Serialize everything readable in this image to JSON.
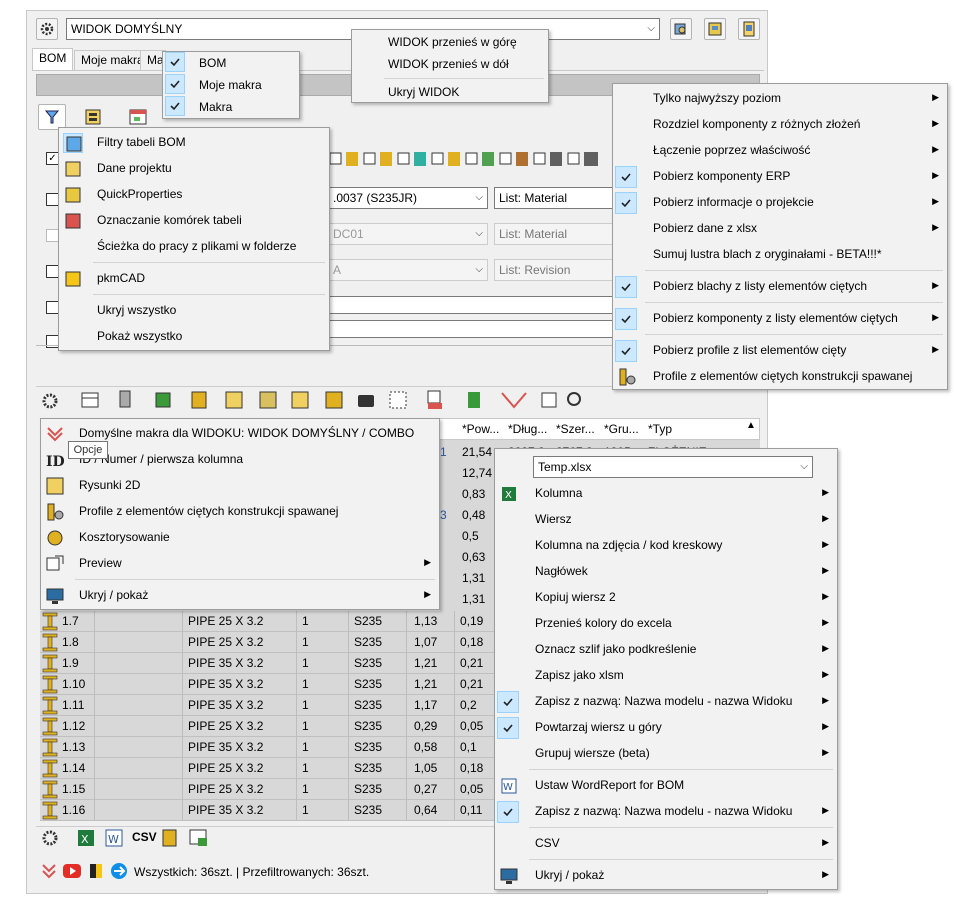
{
  "toolbar": {
    "view_select_value": "WIDOK DOMYŚLNY"
  },
  "tabs": [
    "BOM",
    "Moje makra",
    "Mak"
  ],
  "tab_menu": [
    {
      "label": "BOM",
      "checked": true
    },
    {
      "label": "Moje makra",
      "checked": true
    },
    {
      "label": "Makra",
      "checked": true
    }
  ],
  "view_menu": [
    "WIDOK przenieś w górę",
    "WIDOK przenieś w dół",
    "Ukryj WIDOK"
  ],
  "filter_menu": [
    "Filtry tabeli BOM",
    "Dane projektu",
    "QuickProperties",
    "Oznaczanie komórek tabeli",
    "Ścieżka do pracy z plikami w folderze",
    "pkmCAD",
    "Ukryj wszystko",
    "Pokaż wszystko"
  ],
  "erp_menu": [
    {
      "label": "Tylko najwyższy poziom",
      "checked": false,
      "submenu": true
    },
    {
      "label": "Rozdziel komponenty z różnych złożeń",
      "checked": false,
      "submenu": true
    },
    {
      "label": "Łączenie poprzez właściwość",
      "checked": false,
      "submenu": true
    },
    {
      "label": "Pobierz komponenty ERP",
      "checked": true,
      "submenu": true
    },
    {
      "label": "Pobierz informacje o projekcie",
      "checked": true,
      "submenu": true
    },
    {
      "label": "Pobierz dane z xlsx",
      "checked": false,
      "submenu": true
    },
    {
      "label": "Sumuj lustra blach z oryginałami - BETA!!!*",
      "checked": false,
      "submenu": false
    },
    {
      "label": "Pobierz blachy z listy elementów ciętych",
      "checked": true,
      "submenu": true
    },
    {
      "label": "Pobierz komponenty z listy elementów ciętych",
      "checked": true,
      "submenu": true
    },
    {
      "label": "Pobierz profile z list elementów cięty",
      "checked": true,
      "submenu": true
    },
    {
      "label": "Profile z elementów ciętych konstrukcji spawanej",
      "checked": false,
      "submenu": false
    }
  ],
  "mid_fields": {
    "material_value": ".0037 (S235JR)",
    "list_material_1": "List: Material",
    "dc_value": "DC01",
    "list_material_2": "List: Material",
    "a_value": "A",
    "list_revision": "List: Revision"
  },
  "options_menu": [
    "Domyślne makra dla WIDOKU: WIDOK DOMYŚLNY / COMBO",
    "ID / Numer / pierwsza kolumna",
    "Rysunki 2D",
    "Profile z elementów ciętych konstrukcji spawanej",
    "Kosztorysowanie",
    "Preview",
    "Ukryj / pokaż"
  ],
  "options_tooltip": "Opcje",
  "grid_headers": [
    "*Pow...",
    "*Dług...",
    "*Szer...",
    "*Gru...",
    "*Typ"
  ],
  "grid_peek": {
    "a": [
      "21,54",
      "12,74",
      "0,83",
      "0,48",
      "0,5",
      "0,63",
      "1,31",
      "1,31"
    ],
    "b": [
      "1",
      "",
      "",
      "3",
      "",
      "",
      "",
      ""
    ],
    "first_row": [
      "2237,2",
      "2767,8",
      "1805",
      "ZŁOŻENIE"
    ]
  },
  "rows": [
    {
      "id": "1.7",
      "name": "PIPE 25 X 3.2",
      "qty": "1",
      "mat": "S235",
      "v1": "1,13",
      "v2": "0,19"
    },
    {
      "id": "1.8",
      "name": "PIPE 25 X 3.2",
      "qty": "1",
      "mat": "S235",
      "v1": "1,07",
      "v2": "0,18"
    },
    {
      "id": "1.9",
      "name": "PIPE 35 X 3.2",
      "qty": "1",
      "mat": "S235",
      "v1": "1,21",
      "v2": "0,21"
    },
    {
      "id": "1.10",
      "name": "PIPE 35 X 3.2",
      "qty": "1",
      "mat": "S235",
      "v1": "1,21",
      "v2": "0,21"
    },
    {
      "id": "1.11",
      "name": "PIPE 35 X 3.2",
      "qty": "1",
      "mat": "S235",
      "v1": "1,17",
      "v2": "0,2"
    },
    {
      "id": "1.12",
      "name": "PIPE 25 X 3.2",
      "qty": "1",
      "mat": "S235",
      "v1": "0,29",
      "v2": "0,05"
    },
    {
      "id": "1.13",
      "name": "PIPE 35 X 3.2",
      "qty": "1",
      "mat": "S235",
      "v1": "0,58",
      "v2": "0,1"
    },
    {
      "id": "1.14",
      "name": "PIPE 25 X 3.2",
      "qty": "1",
      "mat": "S235",
      "v1": "1,05",
      "v2": "0,18"
    },
    {
      "id": "1.15",
      "name": "PIPE 25 X 3.2",
      "qty": "1",
      "mat": "S235",
      "v1": "0,27",
      "v2": "0,05"
    },
    {
      "id": "1.16",
      "name": "PIPE 35 X 3.2",
      "qty": "1",
      "mat": "S235",
      "v1": "0,64",
      "v2": "0,11"
    }
  ],
  "export_menu": {
    "file_select": "Temp.xlsx",
    "items": [
      {
        "label": "Kolumna",
        "checked": false,
        "submenu": true
      },
      {
        "label": "Wiersz",
        "checked": false,
        "submenu": true
      },
      {
        "label": "Kolumna na zdjęcia / kod kreskowy",
        "checked": false,
        "submenu": true
      },
      {
        "label": "Nagłówek",
        "checked": false,
        "submenu": true
      },
      {
        "label": "Kopiuj wiersz 2",
        "checked": false,
        "submenu": true
      },
      {
        "label": "Przenieś kolory do excela",
        "checked": false,
        "submenu": true
      },
      {
        "label": "Oznacz szlif jako podkreślenie",
        "checked": false,
        "submenu": true
      },
      {
        "label": "Zapisz jako xlsm",
        "checked": false,
        "submenu": true
      },
      {
        "label": "Zapisz z nazwą: Nazwa modelu - nazwa Widoku",
        "checked": true,
        "submenu": true
      },
      {
        "label": "Powtarzaj wiersz u góry",
        "checked": true,
        "submenu": true
      },
      {
        "label": "Grupuj wiersze (beta)",
        "checked": false,
        "submenu": true
      },
      {
        "label": "Ustaw WordReport for BOM",
        "checked": false,
        "submenu": false
      },
      {
        "label": "Zapisz z nazwą: Nazwa modelu - nazwa Widoku",
        "checked": true,
        "submenu": true
      },
      {
        "label": "CSV",
        "checked": false,
        "submenu": true
      },
      {
        "label": "Ukryj / pokaż",
        "checked": false,
        "submenu": true
      }
    ]
  },
  "bottom_bar": {
    "csv_label": "CSV"
  },
  "status": {
    "text": "Wszystkich: 36szt. | Przefiltrowanych: 36szt."
  },
  "colors": {
    "check_bg": "#cce8ff",
    "check_border": "#99d1ff",
    "icon_gold": "#e0b020",
    "grid_gray": "#d8d8d8"
  }
}
